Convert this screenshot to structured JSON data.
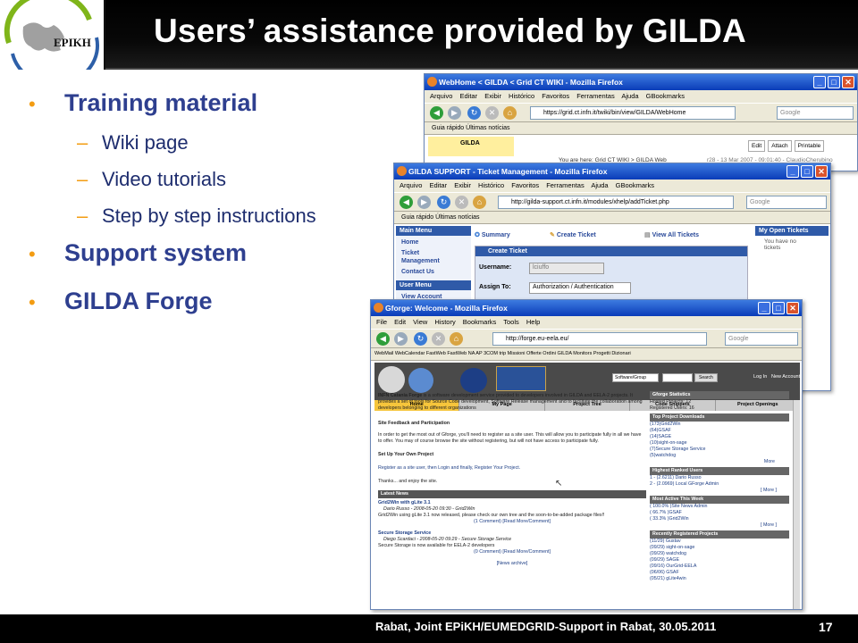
{
  "slide": {
    "logo_text": "EPIKH",
    "title": "Users’ assistance provided by GILDA",
    "bullets": [
      {
        "label": "Training material",
        "sub": [
          "Wiki page",
          "Video tutorials",
          "Step by step instructions"
        ]
      },
      {
        "label": "Support system",
        "sub": []
      },
      {
        "label": "GILDA Forge",
        "sub": []
      }
    ],
    "footer": "Rabat, Joint EPiKH/EUMEDGRID-Support in Rabat, 30.05.2011",
    "page_number": "17"
  },
  "wiki_window": {
    "title": "WebHome < GILDA < Grid CT WIKI - Mozilla Firefox",
    "menu": "Arquivo Editar Exibir Histórico Favoritos Ferramentas Ajuda GBookmarks",
    "url": "https://grid.ct.infn.it/twiki/bin/view/GILDA/WebHome",
    "search_placeholder": "Google",
    "bookmarks": "Guia rápido   Últimas notícias",
    "web_label": "GILDA",
    "breadcrumb": "You are here: Grid CT WIKI > GILDA Web",
    "actions": [
      "Edit",
      "Attach",
      "Printable"
    ],
    "revision": "r28 - 13 Mar 2007 - 09:01:40 - ClaudioCherubino"
  },
  "ticket_window": {
    "title": "GILDA SUPPORT - Ticket Management - Mozilla Firefox",
    "menu": "Arquivo Editar Exibir Histórico Favoritos Ferramentas Ajuda GBookmarks",
    "url": "http://gilda-support.ct.infn.it/modules/xhelp/addTicket.php",
    "search_placeholder": "Google",
    "bookmarks": "Guia rápido   Últimas notícias",
    "main_menu_title": "Main Menu",
    "main_menu": [
      "Home",
      "Ticket Management",
      "Contact Us"
    ],
    "user_menu_title": "User Menu",
    "user_menu": [
      "View Account"
    ],
    "tabs": [
      "Summary",
      "Create Ticket",
      "View All Tickets"
    ],
    "form_title": "Create Ticket",
    "username_label": "Username:",
    "username_value": "lciuffo",
    "assign_label": "Assign To:",
    "assign_value": "Authorization / Authentication",
    "open_tickets_title": "My Open Tickets",
    "open_tickets_text": "You have no tickets"
  },
  "forge_window": {
    "title": "Gforge: Welcome - Mozilla Firefox",
    "menu": "File Edit View History Bookmarks Tools Help",
    "url": "http://forge.eu-eela.eu/",
    "search_placeholder": "Google",
    "bookmarks": "WebMail  WebCalendar  FastWeb  FastWeb NA  AP 3COM trip  Missioni  Offerte  Ordini  GILDA  Monitors  Progetti  Dizionari",
    "header_select": "Software/Group",
    "header_search": "Search",
    "login": "Log In",
    "new_account": "New Account",
    "nav_tabs": [
      "Home",
      "My Page",
      "Project Tree",
      "Code Snippets",
      "Project Openings"
    ],
    "intro_bold": "INFN Catania Forge",
    "intro": " is a software development service provided to developers involved in GILDA and EELA-2 projects. It provides a set of tools for Source Code development, Software Release management and to facilitate the collaboration among developers belonging to different organizations",
    "site_feedback_title": "Site Feedback and Participation",
    "site_feedback": "In order to get the most out of Gforge, you'll need to register as a site user. This will allow you to participate fully in all we have to offer. You may of course browse the site without registering, but will not have access to participate fully.",
    "setup_title": "Set Up Your Own Project",
    "setup": "Register as a site user, then Login and finally, Register Your Project.",
    "thanks": "Thanks... and enjoy the site.",
    "latest_news_title": "Latest News",
    "news": [
      {
        "title": "Grid2Win with gLite 3.1",
        "meta": "Dario Russo - 2008-05-20 09:30 - Grid2Win",
        "text": "Grid2Win using gLite 3.1 now released, please check our own tree and the soon-to-be-added package files!!",
        "comments": "(1 Comment) [Read More/Comment]"
      },
      {
        "title": "Secure Storage Service",
        "meta": "Diego Scardaci - 2008-05-20 09:29 - Secure Storage Service",
        "text": "Secure Storage is now available for EELA-2 developers",
        "comments": "(0 Comment) [Read More/Comment]"
      }
    ],
    "news_archive": "[News archive]",
    "stats_title": "Gforge Statistics",
    "stats": [
      "Hosted Projects: 12",
      "Registered Users: 16"
    ],
    "top_downloads_title": "Top Project Downloads",
    "top_downloads": [
      "(173)Grid2Win",
      "(64)GSAF",
      "(14)SAGE",
      "(10)sight-on-sage",
      "(7)Secure Storage Service",
      "(5)watchdog"
    ],
    "more": "More",
    "ranked_title": "Highest Ranked Users",
    "ranked": [
      "1 - (2.6211) Dario Russo",
      "2 - (2.0969) Local GForge Admin"
    ],
    "more_bracket": "[ More ]",
    "active_title": "Most Active This Week",
    "active": [
      "( 100.0% )Site News Admin",
      "( 66.7% )GSAF",
      "( 33.3% )Grid2Win"
    ],
    "recent_title": "Recently Registered Projects",
    "recent": [
      "(11/29) Gustav",
      "(09/29) sight-on-sage",
      "(09/29) watchdog",
      "(09/29) SAGE",
      "(09/16) OurGrid-EELA",
      "(06/06) GSAF",
      "(05/21) gLite4win"
    ]
  },
  "colors": {
    "title_text": "#ffffff",
    "bullet_text": "#2e3f8f",
    "bullet_marker": "#f39c12",
    "header_bg": "#000000"
  }
}
